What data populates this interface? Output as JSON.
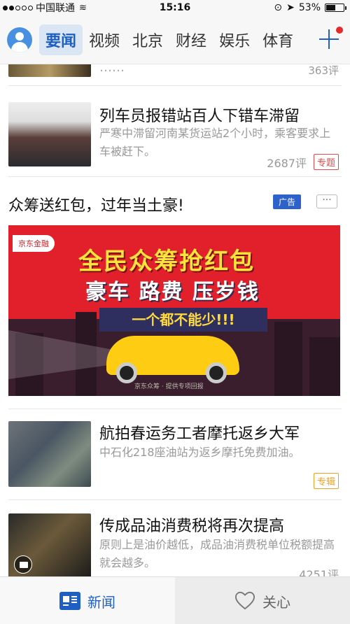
{
  "status_bar": {
    "carrier": "中国联通",
    "time": "15:16",
    "battery_percent": "53%",
    "battery_level": 0.53,
    "signal_bars": 2
  },
  "nav": {
    "tabs": [
      "要闻",
      "视频",
      "北京",
      "财经",
      "娱乐",
      "体育"
    ],
    "active_tab": "要闻",
    "accent_color": "#1f5fc2"
  },
  "feed": {
    "partial_item": {
      "title_fragment": "……",
      "comments": "363评"
    },
    "items": [
      {
        "title": "列车员报错站百人下错车滞留",
        "desc": "严寒中滞留河南某货运站2个小时，乘客要求上车被赶下。",
        "comments": "2687评",
        "tag": "专题"
      },
      {
        "title": "航拍春运务工者摩托返乡大军",
        "desc": "中石化218座油站为返乡摩托免费加油。",
        "comments": "",
        "tag": "专辑"
      },
      {
        "title": "传成品油消费税将再次提高",
        "desc": "原则上是油价越低，成品油消费税单位税额提高就会越多。",
        "comments": "4251评",
        "tag": ""
      }
    ],
    "ad": {
      "title": "众筹送红包，过年当土豪!",
      "badge": "广告",
      "more": "···",
      "banner": {
        "logo": "京东金融",
        "headline": "全民众筹抢红包",
        "subline": "豪车 路费 压岁钱",
        "ribbon": "一个都不能少!!!",
        "footer": "京东众筹 · 提供专项回报"
      }
    }
  },
  "bottom_bar": {
    "news_label": "新闻",
    "care_label": "关心"
  }
}
